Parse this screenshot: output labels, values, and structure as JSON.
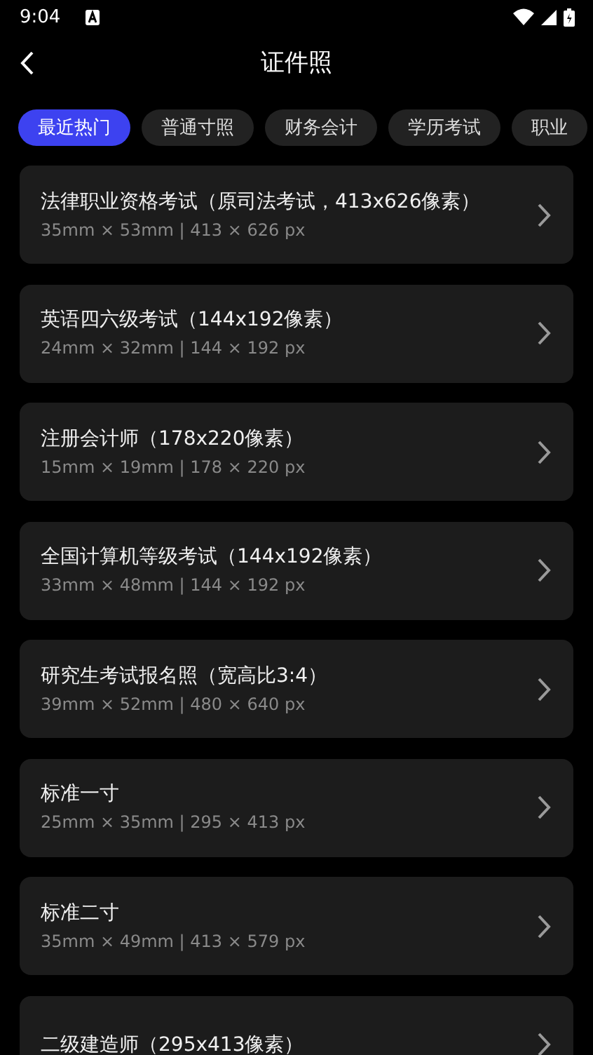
{
  "status_bar": {
    "time": "9:04"
  },
  "header": {
    "title": "证件照"
  },
  "tabs": [
    {
      "label": "最近热门",
      "selected": true
    },
    {
      "label": "普通寸照",
      "selected": false
    },
    {
      "label": "财务会计",
      "selected": false
    },
    {
      "label": "学历考试",
      "selected": false
    },
    {
      "label": "职业",
      "selected": false
    }
  ],
  "items": [
    {
      "title": "法律职业资格考试（原司法考试，413x626像素）",
      "spec": "35mm × 53mm | 413 × 626 px"
    },
    {
      "title": "英语四六级考试（144x192像素）",
      "spec": "24mm × 32mm | 144 × 192 px"
    },
    {
      "title": "注册会计师（178x220像素）",
      "spec": "15mm × 19mm | 178 × 220 px"
    },
    {
      "title": "全国计算机等级考试（144x192像素）",
      "spec": "33mm × 48mm | 144 × 192 px"
    },
    {
      "title": "研究生考试报名照（宽高比3:4）",
      "spec": "39mm × 52mm | 480 × 640 px"
    },
    {
      "title": "标准一寸",
      "spec": "25mm × 35mm | 295 × 413 px"
    },
    {
      "title": "标准二寸",
      "spec": "35mm × 49mm | 413 × 579 px"
    },
    {
      "title": "二级建造师（295x413像素）"
    }
  ]
}
